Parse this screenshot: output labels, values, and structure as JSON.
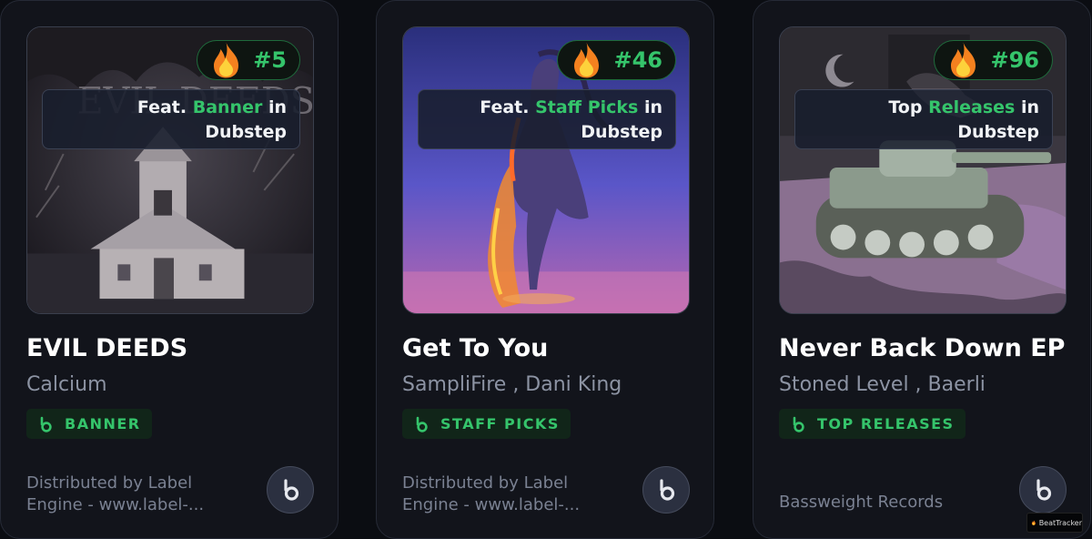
{
  "cards": [
    {
      "rank": "#5",
      "feat_prefix": "Feat. ",
      "feat_highlight": "Banner",
      "feat_suffix": " in",
      "genre": "Dubstep",
      "title": "EVIL DEEDS",
      "artist": "Calcium",
      "badge": "BANNER",
      "distributor": "Distributed by Label Engine - www.label-..."
    },
    {
      "rank": "#46",
      "feat_prefix": "Feat. ",
      "feat_highlight": "Staff Picks",
      "feat_suffix": " in",
      "genre": "Dubstep",
      "title": "Get To You",
      "artist": "SampliFire , Dani King",
      "badge": "STAFF PICKS",
      "distributor": "Distributed by Label Engine - www.label-..."
    },
    {
      "rank": "#96",
      "feat_prefix": "Top ",
      "feat_highlight": "Releases",
      "feat_suffix": " in",
      "genre": "Dubstep",
      "title": "Never Back Down EP",
      "artist": "Stoned Level , Baerli",
      "badge": "TOP RELEASES",
      "distributor": "Bassweight Records"
    }
  ],
  "watermark": {
    "label": "BeatTracker"
  },
  "colors": {
    "accent_green": "#35c46b",
    "card_bg": "#12141b",
    "page_bg": "#0b0d12"
  }
}
